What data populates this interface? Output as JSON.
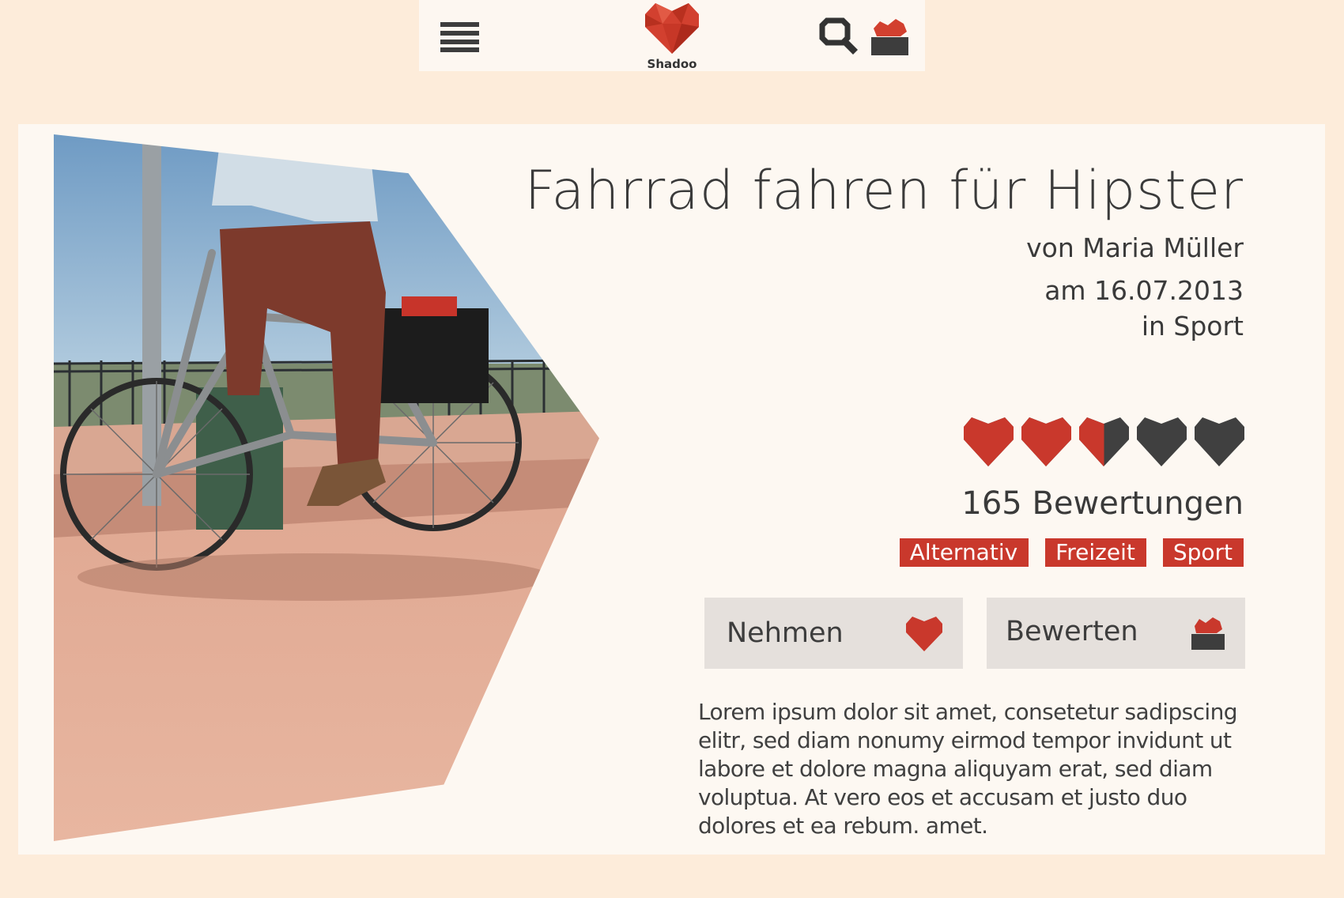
{
  "app": {
    "logo_text": "Shadoo"
  },
  "header": {
    "menu_icon": "hamburger-menu-icon",
    "search_icon": "search-icon",
    "inbox_icon": "inbox-heart-icon"
  },
  "article": {
    "title": "Fahrrad fahren für Hipster",
    "author": "von Maria Müller",
    "date": "am 16.07.2013",
    "category": "in Sport",
    "rating": {
      "value": 2.5,
      "max": 5
    },
    "reviews": "165 Bewertungen",
    "tags": [
      "Alternativ",
      "Freizeit",
      "Sport"
    ],
    "description": "Lorem ipsum dolor sit amet, consetetur sadipscing elitr, sed diam nonumy eirmod tempor invidunt ut labore et dolore magna aliquyam erat, sed diam voluptua. At vero eos et accusam et justo duo dolores et ea rebum. amet."
  },
  "actions": {
    "take_label": "Nehmen",
    "rate_label": "Bewerten"
  },
  "colors": {
    "background": "#fdecda",
    "card": "#fdf8f2",
    "accent_red": "#c9382c",
    "dark_gray": "#404040",
    "button_bg": "#e5e0dc"
  }
}
